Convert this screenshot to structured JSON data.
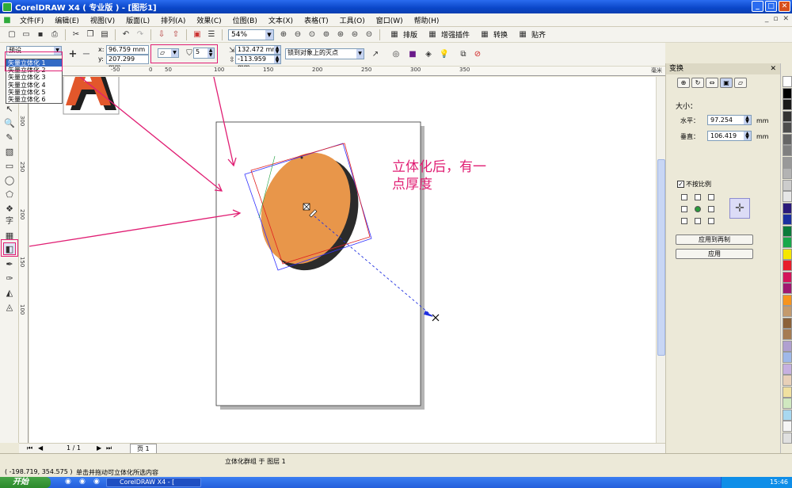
{
  "window": {
    "title": "CorelDRAW X4 ( 专业版 ) - [图形1]"
  },
  "menu": [
    "文件(F)",
    "编辑(E)",
    "视图(V)",
    "版面(L)",
    "排列(A)",
    "效果(C)",
    "位图(B)",
    "文本(X)",
    "表格(T)",
    "工具(O)",
    "窗口(W)",
    "帮助(H)"
  ],
  "toolbar": {
    "zoom": "54%",
    "layout_label": "排版",
    "enhance_label": "增强插件",
    "convert_label": "转换",
    "paste_label": "贴齐"
  },
  "propbar": {
    "preset_value": "预设",
    "x": "96.759 mm",
    "y": "207.299 mm",
    "depth": "5",
    "vp_x": "132.472 mm",
    "vp_y": "-113.959 mm",
    "vp_lock": "锁到对象上的灭点"
  },
  "preset_list": [
    "矢量立体化 1",
    "矢量立体化 2",
    "矢量立体化 3",
    "矢量立体化 4",
    "矢量立体化 5",
    "矢量立体化 6"
  ],
  "ruler": {
    "h_labels": [
      "-50",
      "0",
      "50",
      "100",
      "150",
      "200",
      "250",
      "300",
      "350",
      "毫米"
    ],
    "v_labels": [
      "300",
      "250",
      "200",
      "150",
      "100"
    ]
  },
  "annotation": {
    "line1": "立体化后，有一",
    "line2": "点厚度"
  },
  "bottombar": {
    "page_count": "1 / 1",
    "page_tab": "页 1"
  },
  "status": {
    "object_info": "立体化群组 于 图层 1",
    "coords": "( -198.719, 354.575 )",
    "hint": "单击并拖动可立体化所选内容"
  },
  "taskbar": {
    "start": "开始",
    "task": "CorelDRAW X4 - [",
    "clock": "15:46",
    "ime_label": "中"
  },
  "dock": {
    "title": "变换",
    "size_label": "大小：",
    "h_label": "水平：",
    "h_value": "97.254",
    "v_label": "垂直：",
    "v_value": "106.419",
    "unit": "mm",
    "proportional_label": "不按比例",
    "apply_duplicate": "应用到再制",
    "apply": "应用"
  },
  "palette": [
    "#ffffff",
    "#000000",
    "#1a1a1a",
    "#333333",
    "#4d4d4d",
    "#666666",
    "#808080",
    "#999999",
    "#b3b3b3",
    "#cccccc",
    "#e6e6e6",
    "#2a1a7a",
    "#1a2fa0",
    "#0b7a3a",
    "#18a84a",
    "#f5e600",
    "#e81e2b",
    "#d4145a",
    "#a01870",
    "#f7941d",
    "#c49a6c",
    "#8c6239",
    "#a67c52",
    "#b0a0d0",
    "#9fb8e8",
    "#c6b0e0",
    "#e8d0b8",
    "#f0e0a0",
    "#d0e8c0",
    "#a8d8f0",
    "#f5f5f5",
    "#e0e0e0"
  ],
  "colors": {
    "accent": "#e01e73",
    "object": "#e8964a",
    "shadow": "#2b2b2b"
  }
}
